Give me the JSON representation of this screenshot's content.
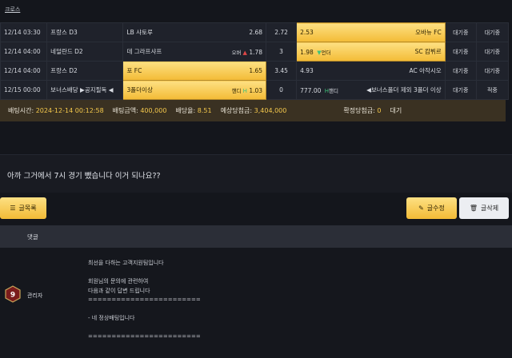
{
  "breadcrumb": "크로스",
  "bets": [
    {
      "date": "12/14 03:30",
      "league": "프랑스 D3",
      "home": "LB 샤토루",
      "home_mark": "",
      "home_odds": "2.68",
      "draw": "2.72",
      "away_odds": "2.53",
      "away_mark": "",
      "away": "오바뉴 FC",
      "status": "대기중",
      "result": "대기중",
      "selected": "away"
    },
    {
      "date": "12/14 04:00",
      "league": "네덜란드 D2",
      "home": "데 그라프샤프",
      "home_mark": "오버",
      "home_odds": "1.78",
      "draw": "3",
      "away_odds": "1.98",
      "away_mark": "언더",
      "away": "SC 캄뷔르",
      "status": "대기중",
      "result": "대기중",
      "selected": "away"
    },
    {
      "date": "12/14 04:00",
      "league": "프랑스 D2",
      "home": "포 FC",
      "home_mark": "",
      "home_odds": "1.65",
      "draw": "3.45",
      "away_odds": "4.93",
      "away_mark": "",
      "away": "AC 아작시오",
      "status": "대기중",
      "result": "대기중",
      "selected": "home"
    },
    {
      "date": "12/15 00:00",
      "league": "보너스배당 ▶공지필독 ◀",
      "home": "3폴더이상",
      "home_mark": "핸디",
      "home_odds": "1.03",
      "draw": "0",
      "away_odds": "777.00",
      "away_mark": "핸디",
      "away": "◀보너스폴더 제외 3폴더 이상",
      "status": "대기중",
      "result": "적중",
      "selected": "home"
    }
  ],
  "summary": {
    "bet_time_label": "배팅시간:",
    "bet_time": "2024-12-14 00:12:58",
    "amount_label": "배팅금액:",
    "amount": "400,000",
    "odds_label": "배당율:",
    "odds": "8.51",
    "expected_label": "예상당첨금:",
    "expected": "3,404,000",
    "confirmed_label": "확정당첨금:",
    "confirmed": "0",
    "state": "대기"
  },
  "post": {
    "text": "아까 그거에서 7시 경기 뺐습니다 이거 되나요??"
  },
  "buttons": {
    "list": "글목록",
    "edit": "글수정",
    "delete": "글삭제"
  },
  "comments": {
    "header": "댓글",
    "author": "관리자",
    "level": "9",
    "lines": [
      "최선을 다하는 고객지원팀입니다",
      "",
      "회원님의 문의에 관련하여",
      "다음과 같이 답변 드립니다",
      "========================",
      "",
      "- 네 정상배팅입니다",
      "",
      "========================"
    ]
  },
  "colors": {
    "accent": "#f4c84c",
    "win": "#f4c84c",
    "up": "#e04747",
    "down": "#3ec27a"
  }
}
